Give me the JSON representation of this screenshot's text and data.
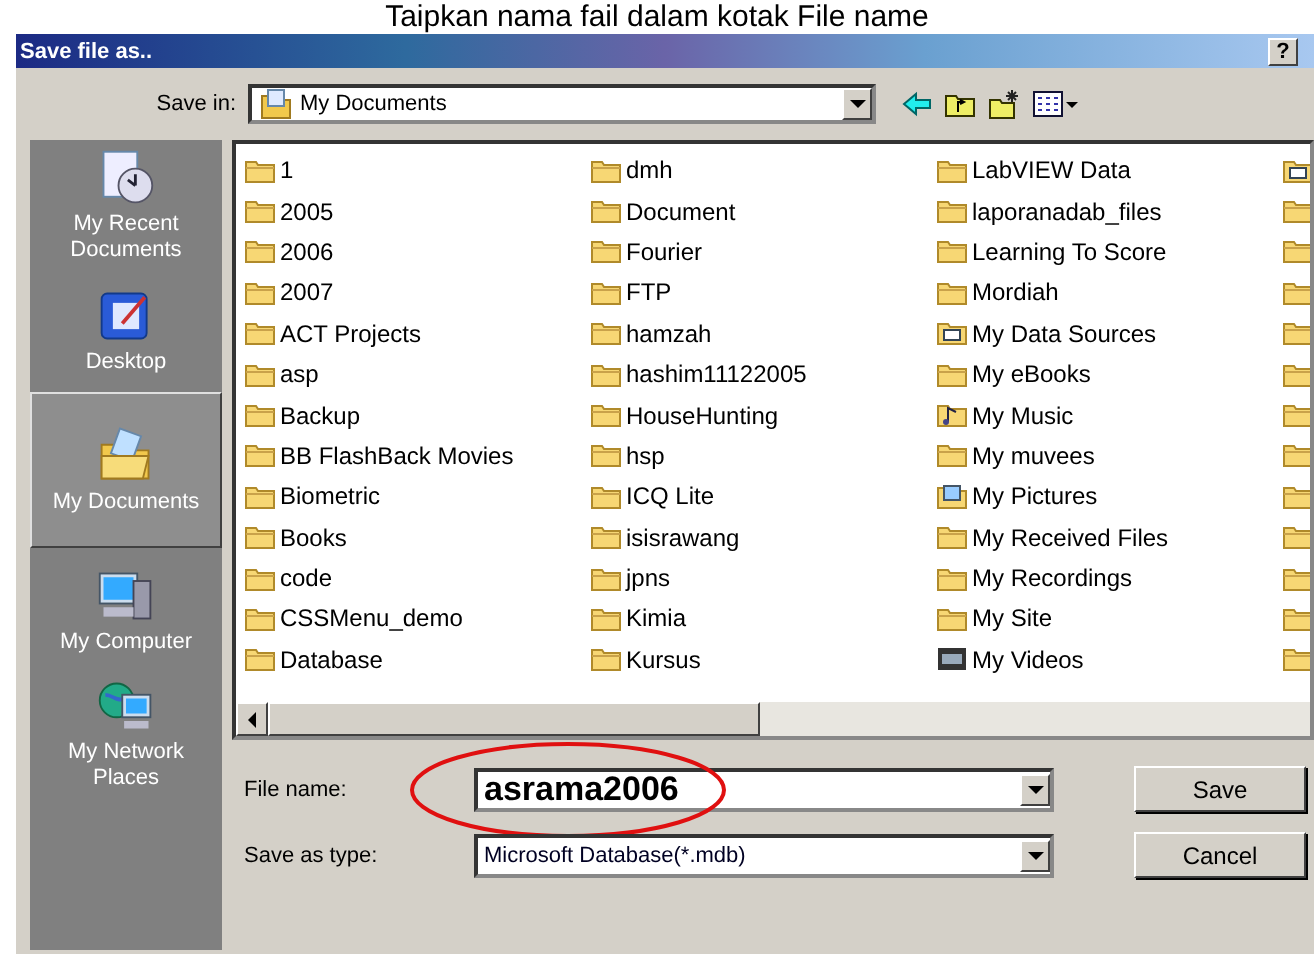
{
  "caption": "Taipkan nama fail dalam kotak File name",
  "window": {
    "title": "Save file as..",
    "help": "?"
  },
  "save_in": {
    "label": "Save in:",
    "value": "My Documents"
  },
  "places": [
    {
      "label": "My Recent Documents",
      "kind": "recent",
      "selected": false
    },
    {
      "label": "Desktop",
      "kind": "desktop",
      "selected": false
    },
    {
      "label": "My Documents",
      "kind": "documents",
      "selected": true
    },
    {
      "label": "My Computer",
      "kind": "computer",
      "selected": false
    },
    {
      "label": "My Network Places",
      "kind": "network",
      "selected": false
    }
  ],
  "files": [
    [
      {
        "name": "1",
        "kind": "folder"
      },
      {
        "name": "2005",
        "kind": "folder"
      },
      {
        "name": "2006",
        "kind": "folder"
      },
      {
        "name": "2007",
        "kind": "folder"
      },
      {
        "name": "ACT Projects",
        "kind": "folder"
      },
      {
        "name": "asp",
        "kind": "folder"
      },
      {
        "name": "Backup",
        "kind": "folder"
      },
      {
        "name": "BB FlashBack Movies",
        "kind": "folder"
      },
      {
        "name": "Biometric",
        "kind": "folder"
      },
      {
        "name": "Books",
        "kind": "folder"
      },
      {
        "name": "code",
        "kind": "folder"
      },
      {
        "name": "CSSMenu_demo",
        "kind": "folder"
      },
      {
        "name": "Database",
        "kind": "folder"
      }
    ],
    [
      {
        "name": "dmh",
        "kind": "folder"
      },
      {
        "name": "Document",
        "kind": "folder"
      },
      {
        "name": "Fourier",
        "kind": "folder"
      },
      {
        "name": "FTP",
        "kind": "folder"
      },
      {
        "name": "hamzah",
        "kind": "folder"
      },
      {
        "name": "hashim11122005",
        "kind": "folder"
      },
      {
        "name": "HouseHunting",
        "kind": "folder"
      },
      {
        "name": "hsp",
        "kind": "folder"
      },
      {
        "name": "ICQ Lite",
        "kind": "folder"
      },
      {
        "name": "isisrawang",
        "kind": "folder"
      },
      {
        "name": "jpns",
        "kind": "folder"
      },
      {
        "name": "Kimia",
        "kind": "folder"
      },
      {
        "name": "Kursus",
        "kind": "folder"
      }
    ],
    [
      {
        "name": "LabVIEW Data",
        "kind": "folder"
      },
      {
        "name": "laporanadab_files",
        "kind": "folder"
      },
      {
        "name": "Learning To Score",
        "kind": "folder"
      },
      {
        "name": "Mordiah",
        "kind": "folder"
      },
      {
        "name": "My Data Sources",
        "kind": "datasource"
      },
      {
        "name": "My eBooks",
        "kind": "folder"
      },
      {
        "name": "My Music",
        "kind": "music"
      },
      {
        "name": "My muvees",
        "kind": "folder"
      },
      {
        "name": "My Pictures",
        "kind": "pictures"
      },
      {
        "name": "My Received Files",
        "kind": "folder"
      },
      {
        "name": "My Recordings",
        "kind": "folder"
      },
      {
        "name": "My Site",
        "kind": "folder"
      },
      {
        "name": "My Videos",
        "kind": "videos"
      }
    ],
    [
      {
        "kind": "datasource"
      },
      {
        "kind": "folder"
      },
      {
        "kind": "folder"
      },
      {
        "kind": "folder"
      },
      {
        "kind": "folder"
      },
      {
        "kind": "folder"
      },
      {
        "kind": "folder"
      },
      {
        "kind": "folder"
      },
      {
        "kind": "folder"
      },
      {
        "kind": "folder"
      },
      {
        "kind": "folder"
      },
      {
        "kind": "folder"
      },
      {
        "kind": "folder"
      }
    ]
  ],
  "file_name": {
    "label": "File name:",
    "value": "asrama2006"
  },
  "save_as_type": {
    "label": "Save as type:",
    "value": "Microsoft Database(*.mdb)"
  },
  "buttons": [
    {
      "label": "Save"
    },
    {
      "label": "Cancel"
    }
  ]
}
